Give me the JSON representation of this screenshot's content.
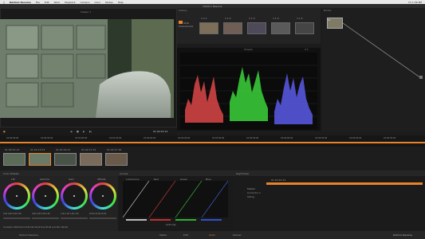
{
  "menubar": {
    "app": "DaVinci Resolve",
    "items": [
      "File",
      "Edit",
      "Work",
      "Playback",
      "Camera",
      "Color",
      "Nodes",
      "Help"
    ],
    "right": [
      "Fri 1:56 PM"
    ]
  },
  "window_title": "DaVinci Resolve",
  "viewer": {
    "label": "Viewer 1",
    "timecode": "01:02:22:14"
  },
  "gallery": {
    "label": "Gallery",
    "still_label": "Stills",
    "album_label": "PowerGrade",
    "thumb_labels": [
      "1.1.1",
      "1.1.2",
      "1.1.3",
      "1.1.4",
      "1.1.5"
    ]
  },
  "scopes": {
    "label": "Scopes",
    "zoom": "1:1"
  },
  "nodes": {
    "label": "Nodes",
    "node_label": "01"
  },
  "transport": {
    "timecode": "01:02:22:14"
  },
  "timeline": {
    "timecodes": [
      "01:00:00:00",
      "01:00:30:00",
      "01:01:00:00",
      "01:01:30:00",
      "01:02:00:00",
      "01:02:30:00",
      "01:03:00:00",
      "01:03:30:00",
      "01:04:00:00",
      "01:04:30:00",
      "01:05:00:00",
      "01:05:30:00"
    ]
  },
  "clips": [
    {
      "tc": "01:00:31:13",
      "num": "01"
    },
    {
      "tc": "01:01:13:13",
      "num": "02"
    },
    {
      "tc": "01:01:54:11",
      "num": "03"
    },
    {
      "tc": "01:02:17:15",
      "num": "04"
    },
    {
      "tc": "01:02:27:16",
      "num": "05"
    }
  ],
  "toolbar": {
    "wheels_label": "Color Wheels",
    "curves_label": "Curves",
    "keyframes_label": "Keyframes"
  },
  "wheels": {
    "items": [
      {
        "name": "Lift",
        "values": "0.00  0.00  0.00  0.00"
      },
      {
        "name": "Gamma",
        "values": "0.00  0.00  0.00  0.00"
      },
      {
        "name": "Gain",
        "values": "1.00  1.00  1.00  1.00"
      },
      {
        "name": "Offsets",
        "values": "25.00  25.00  25.00"
      }
    ],
    "footer": "Contrast  1.000    Pivot  0.435    Sat  50.00    Hue  50.00    Lum Mix  100.00"
  },
  "curves": {
    "labels": [
      "Luminance",
      "Red",
      "Green",
      "Blue"
    ],
    "soft_clip": "Soft Clip"
  },
  "keyframes": {
    "rows": [
      "Master",
      "Corrector 1",
      "Sizing"
    ],
    "tc": "01:02:22:14"
  },
  "pagebar": {
    "items": [
      "Media",
      "Edit",
      "Color",
      "Deliver"
    ],
    "project": "DaVinci Resolve",
    "brand": "DaVinci Resolve"
  }
}
